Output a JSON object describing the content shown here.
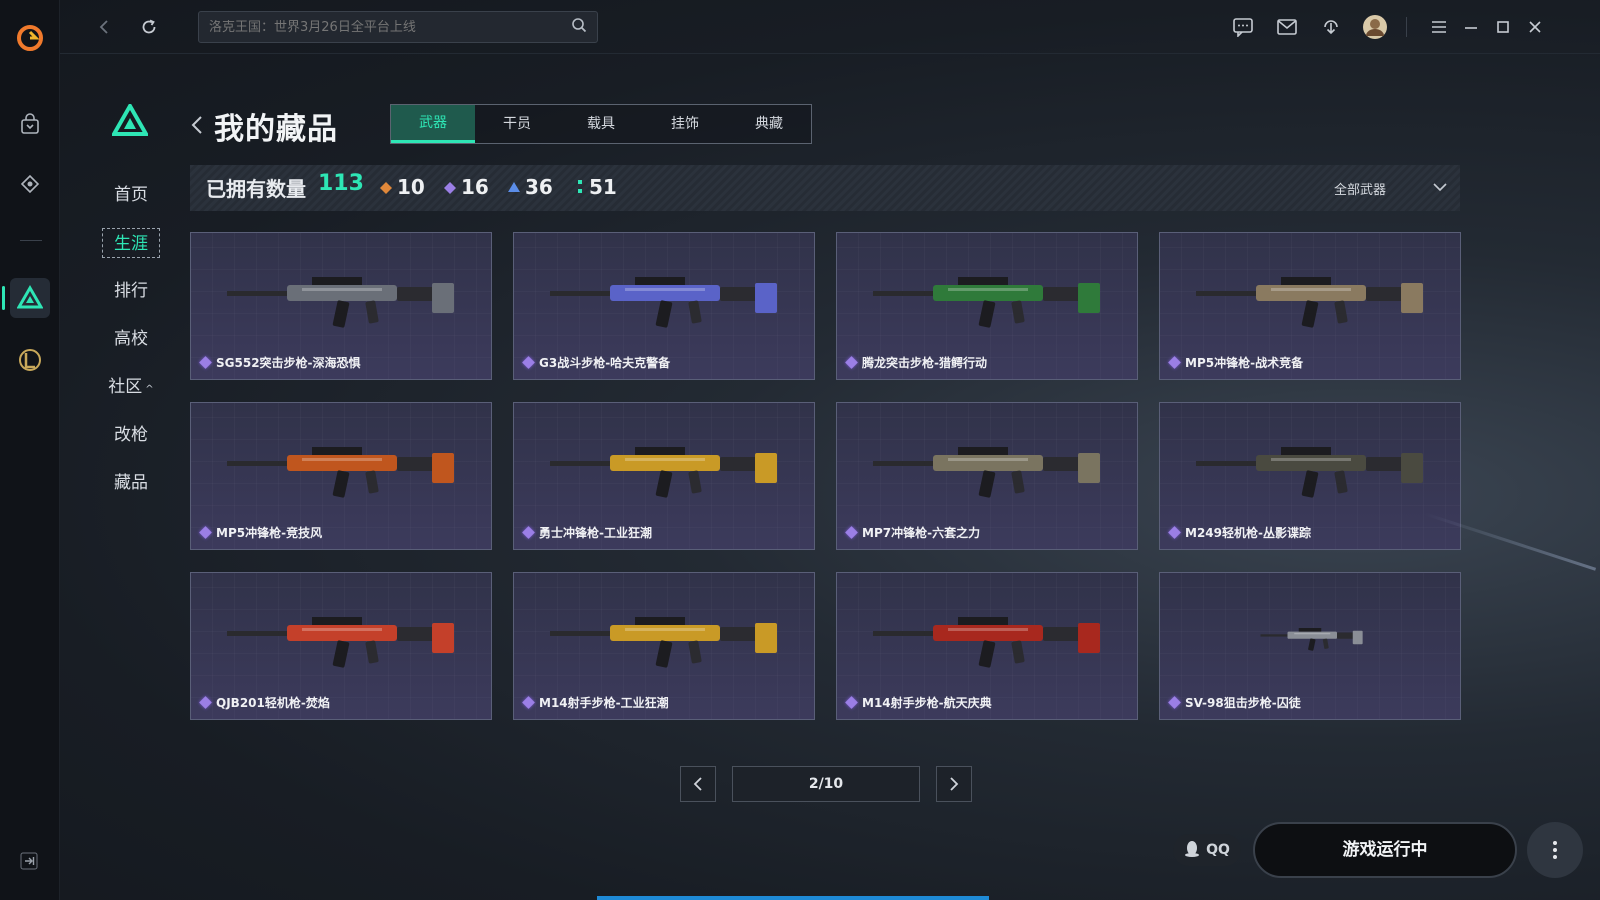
{
  "topbar": {
    "search_placeholder": "洛克王国：世界3月26日全平台上线"
  },
  "secondary_nav": {
    "items": [
      {
        "label": "首页"
      },
      {
        "label": "生涯"
      },
      {
        "label": "排行"
      },
      {
        "label": "高校"
      },
      {
        "label": "社区"
      },
      {
        "label": "改枪"
      },
      {
        "label": "藏品"
      }
    ],
    "active": "生涯"
  },
  "header": {
    "title": "我的藏品",
    "tabs": [
      "武器",
      "干员",
      "载具",
      "挂饰",
      "典藏"
    ],
    "active_tab": "武器"
  },
  "stats": {
    "owned_label": "已拥有数量",
    "owned_value": "113",
    "rarity_counts": [
      {
        "value": "10",
        "color": "#e0883a"
      },
      {
        "value": "16",
        "color": "#9b7fe6"
      },
      {
        "value": "36",
        "color": "#5b8de8"
      },
      {
        "value": "51",
        "color": "#2ee6b5"
      }
    ],
    "filter_label": "全部武器"
  },
  "weapons": [
    {
      "name": "SG552突击步枪-深海恐惧",
      "accent": "#6a6f78"
    },
    {
      "name": "G3战斗步枪-哈夫克警备",
      "accent": "#5a63c8"
    },
    {
      "name": "腾龙突击步枪-猎鳄行动",
      "accent": "#2f7a3a"
    },
    {
      "name": "MP5冲锋枪-战术竞备",
      "accent": "#8a7a60"
    },
    {
      "name": "MP5冲锋枪-竞技风",
      "accent": "#c0561e"
    },
    {
      "name": "勇士冲锋枪-工业狂潮",
      "accent": "#c99a26"
    },
    {
      "name": "MP7冲锋枪-六套之力",
      "accent": "#7a7460"
    },
    {
      "name": "M249轻机枪-丛影谍踪",
      "accent": "#4a4a40"
    },
    {
      "name": "QJB201轻机枪-焚焰",
      "accent": "#c4402a"
    },
    {
      "name": "M14射手步枪-工业狂潮",
      "accent": "#c99a26"
    },
    {
      "name": "M14射手步枪-航天庆典",
      "accent": "#a8281e"
    },
    {
      "name": "SV-98狙击步枪-囚徒",
      "accent": "#8a8e96"
    }
  ],
  "pager": {
    "label": "2/10"
  },
  "bottom": {
    "qq_label": "QQ",
    "run_label": "游戏运行中"
  }
}
